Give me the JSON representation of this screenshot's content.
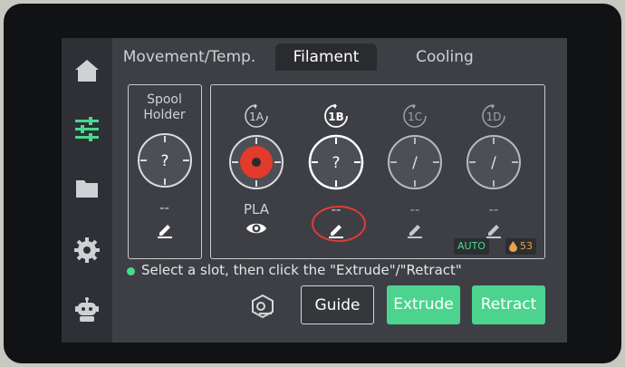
{
  "tabs": [
    {
      "label": "Movement/Temp."
    },
    {
      "label": "Filament"
    },
    {
      "label": "Cooling"
    }
  ],
  "sidebar": {
    "items": [
      "home-icon",
      "sliders-icon",
      "folder-icon",
      "gear-icon",
      "robot-icon"
    ],
    "active_color": "#47d98c"
  },
  "spool_holder": {
    "title": "Spool\nHolder",
    "dial_text": "?",
    "filament": "--"
  },
  "slots": [
    {
      "label": "1A",
      "dial_text": "",
      "filament": "PLA",
      "action_icon": "eye-icon",
      "color": "#e33a2c",
      "selected": false
    },
    {
      "label": "1B",
      "dial_text": "?",
      "filament": "--",
      "action_icon": "edit-icon",
      "color": "",
      "selected": true
    },
    {
      "label": "1C",
      "dial_text": "/",
      "filament": "--",
      "action_icon": "edit-icon",
      "color": "",
      "selected": false
    },
    {
      "label": "1D",
      "dial_text": "/",
      "filament": "--",
      "action_icon": "edit-icon",
      "color": "",
      "selected": false
    }
  ],
  "badges": {
    "auto": "AUTO",
    "humidity": "53"
  },
  "hint": "Select a slot, then click the \"Extrude\"/\"Retract\"",
  "buttons": {
    "guide": "Guide",
    "extrude": "Extrude",
    "retract": "Retract"
  },
  "colors": {
    "accent": "#4cd48f",
    "highlight": "#e23b36",
    "humidity_badge": "#e7a24a"
  }
}
